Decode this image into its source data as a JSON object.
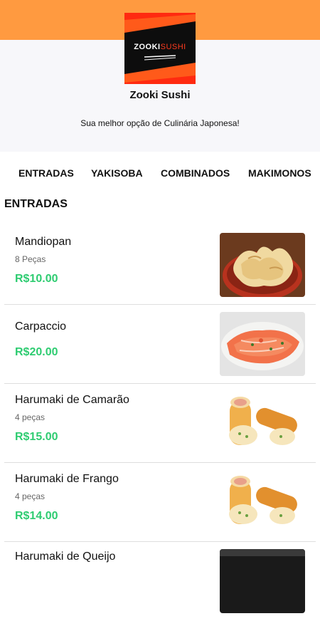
{
  "store": {
    "logo_text_white": "ZOOKI",
    "logo_text_red": "SUSHI",
    "name": "Zooki Sushi",
    "tagline": "Sua melhor opção de Culinária Japonesa!"
  },
  "colors": {
    "header_orange": "#ff9a40",
    "price_green": "#2ecc71",
    "logo_red": "#ff3b1f"
  },
  "tabs": [
    {
      "label": "ENTRADAS"
    },
    {
      "label": "YAKISOBA"
    },
    {
      "label": "COMBINADOS"
    },
    {
      "label": "MAKIMONOS"
    }
  ],
  "section": {
    "title": "ENTRADAS",
    "items": [
      {
        "name": "Mandiopan",
        "desc": "8 Peças",
        "price": "R$10.00",
        "image": "fried-crackers-photo"
      },
      {
        "name": "Carpaccio",
        "desc": "",
        "price": "R$20.00",
        "image": "salmon-carpaccio-photo"
      },
      {
        "name": "Harumaki de Camarão",
        "desc": "4 peças",
        "price": "R$15.00",
        "image": "spring-rolls-photo"
      },
      {
        "name": "Harumaki de Frango",
        "desc": "4 peças",
        "price": "R$14.00",
        "image": "spring-rolls-photo"
      },
      {
        "name": "Harumaki de Queijo",
        "desc": "",
        "price": "",
        "image": "dark-dish-photo"
      }
    ]
  }
}
